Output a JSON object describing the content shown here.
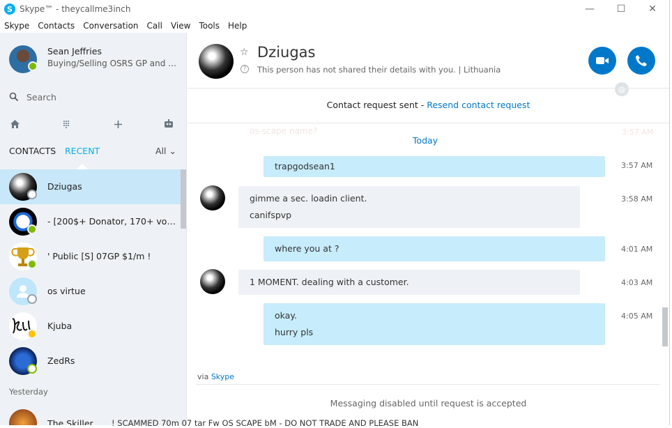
{
  "window": {
    "title": "Skype™ - theycallme3inch",
    "controls": [
      "—",
      "☐",
      "✕"
    ]
  },
  "menu": [
    "Skype",
    "Contacts",
    "Conversation",
    "Call",
    "View",
    "Tools",
    "Help"
  ],
  "profile": {
    "name": "Sean Jeffries",
    "status": "Buying/Selling OSRS GP and OS-..."
  },
  "search": {
    "label": "Search"
  },
  "tabs": {
    "contacts": "CONTACTS",
    "recent": "RECENT",
    "filter": "All"
  },
  "contacts": [
    {
      "name": "Dziugas",
      "presence": "unknown",
      "selected": true
    },
    {
      "name": "- [200$+ Donator, 170+ vou...",
      "presence": "online"
    },
    {
      "name": "' Public [S] 07GP $1/m !",
      "presence": "online"
    },
    {
      "name": "os virtue",
      "presence": "unknown"
    },
    {
      "name": "Kjuba",
      "presence": "away"
    },
    {
      "name": "ZedRs",
      "presence": "empty"
    }
  ],
  "section_yesterday": "Yesterday",
  "yesterday_first": "The Skiller",
  "conversation": {
    "name": "Dziugas",
    "info": "This person has not shared their details with you.  |  Lithuania",
    "request_text": "Contact request sent - ",
    "request_link": "Resend contact request",
    "ghost_text": "os-scape name?",
    "ghost_time": "3:57 AM",
    "day": "Today",
    "messages": [
      {
        "dir": "out",
        "lines": [
          "trapgodsean1"
        ],
        "time": "3:57 AM"
      },
      {
        "dir": "in",
        "lines": [
          "gimme a sec. loadin client.",
          "canifspvp"
        ],
        "time": "3:58 AM"
      },
      {
        "dir": "out",
        "lines": [
          "where you at ?"
        ],
        "time": "4:01 AM"
      },
      {
        "dir": "in",
        "lines": [
          "1 MOMENT. dealing with a customer."
        ],
        "time": "4:03 AM"
      },
      {
        "dir": "out",
        "lines": [
          "okay.",
          "hurry pls"
        ],
        "time": "4:05 AM"
      }
    ],
    "via_prefix": "via ",
    "via_link": "Skype",
    "disabled_note": "Messaging disabled until request is accepted"
  },
  "bleed_text": "! SCAMMED 70m 07 tar Fw OS SCAPE bM - DO NOT TRADE AND PLEASE BAN",
  "colors": {
    "accent": "#00aff0",
    "call_button": "#0078ca",
    "selected_row": "#c8e7f8",
    "outgoing_bubble": "#c7ecfc",
    "incoming_bubble": "#eef2f6"
  }
}
